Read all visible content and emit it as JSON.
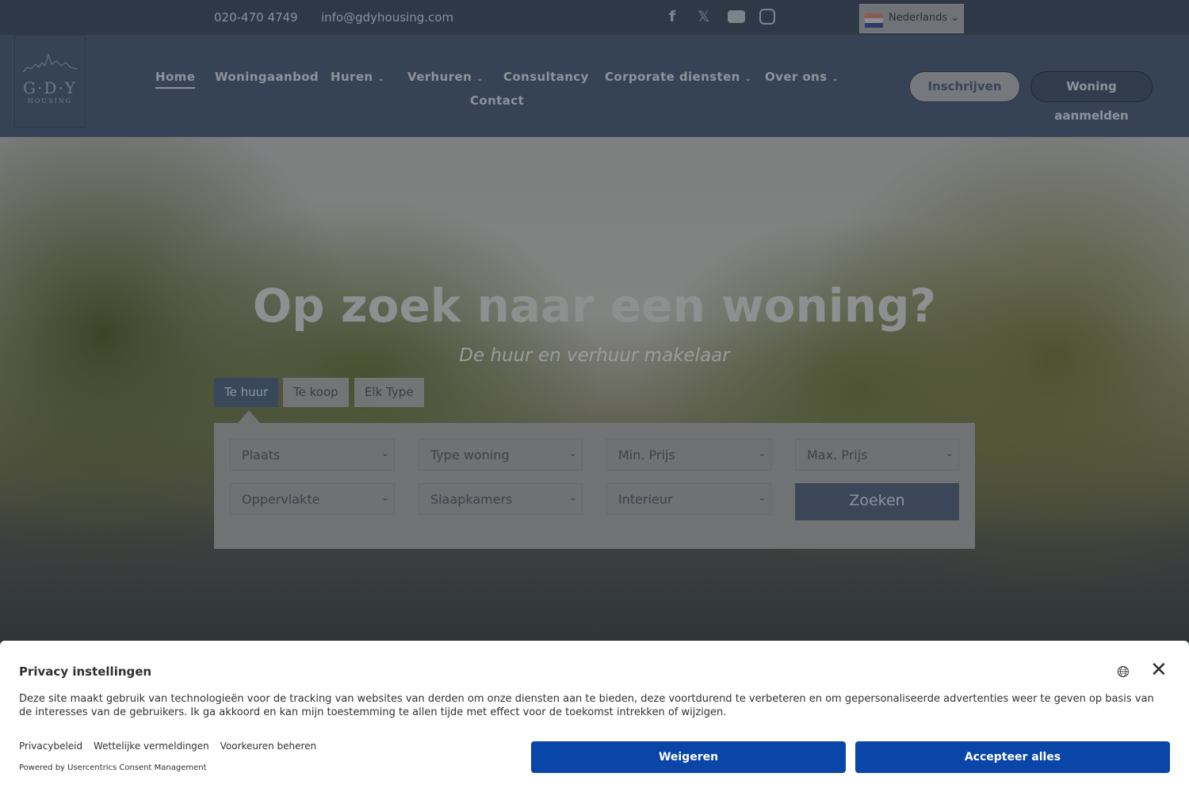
{
  "topbar": {
    "phone": "020-470 4749",
    "email": "info@gdyhousing.com",
    "social": [
      "facebook-icon",
      "x-icon",
      "youtube-icon",
      "instagram-icon"
    ],
    "language": "Nederlands"
  },
  "logo": {
    "name": "G·D·Y",
    "sub": "HOUSING"
  },
  "nav": {
    "items": [
      {
        "label": "Home",
        "active": true
      },
      {
        "label": "Woningaanbod"
      },
      {
        "label": "Huren",
        "dropdown": true
      },
      {
        "label": "Verhuren",
        "dropdown": true
      },
      {
        "label": "Consultancy"
      },
      {
        "label": "Corporate diensten",
        "dropdown": true
      },
      {
        "label": "Over ons",
        "dropdown": true
      },
      {
        "label": "Contact"
      }
    ],
    "signup": "Inschrijven",
    "register_home": "Woning aanmelden"
  },
  "hero": {
    "title": "Op zoek naar een woning?",
    "subtitle": "De huur en verhuur makelaar"
  },
  "search": {
    "tabs": [
      "Te huur",
      "Te koop",
      "Elk Type"
    ],
    "active_tab": "Te huur",
    "fields": [
      "Plaats",
      "Type woning",
      "Min. Prijs",
      "Max. Prijs",
      "Oppervlakte",
      "Slaapkamers",
      "Interieur"
    ],
    "submit": "Zoeken"
  },
  "consent": {
    "title": "Privacy instellingen",
    "body": "Deze site maakt gebruik van technologieën voor de tracking van websites van derden om onze diensten aan te bieden, deze voortdurend te verbeteren en om gepersonaliseerde advertenties weer te geven op basis van de interesses van de gebruikers. Ik ga akkoord en kan mijn toestemming te allen tijde met effect voor de toekomst intrekken of wijzigen.",
    "links": [
      "Privacybeleid",
      "Wettelijke vermeldingen",
      "Voorkeuren beheren"
    ],
    "powered": "Powered by Usercentrics Consent Management",
    "deny": "Weigeren",
    "accept": "Accepteer alles",
    "accent": "#0a45a8"
  }
}
